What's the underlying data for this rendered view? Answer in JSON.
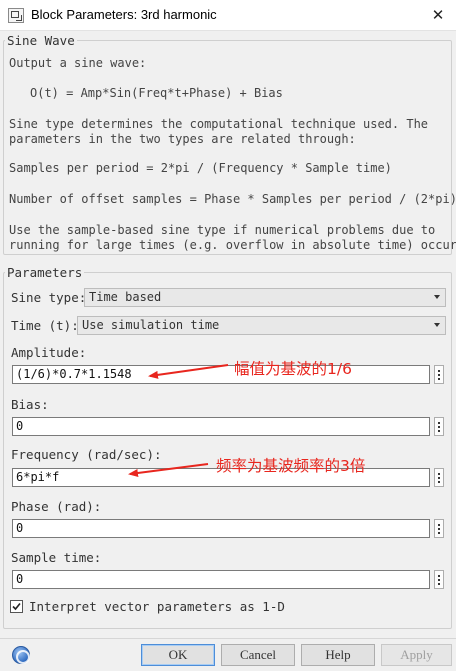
{
  "window": {
    "title": "Block Parameters: 3rd harmonic",
    "close_glyph": "✕"
  },
  "description": {
    "legend": "Sine Wave",
    "lines": [
      "Output a sine wave:",
      "O(t) = Amp*Sin(Freq*t+Phase) + Bias",
      "Sine type determines the computational technique used. The",
      "parameters in the two types are related through:",
      "Samples per period = 2*pi / (Frequency * Sample time)",
      "Number of offset samples = Phase * Samples per period / (2*pi)",
      "Use the sample-based sine type if numerical problems due to",
      "running for large times (e.g. overflow in absolute time) occur."
    ]
  },
  "parameters": {
    "legend": "Parameters",
    "sine_type": {
      "label": "Sine type:",
      "value": "Time based"
    },
    "time": {
      "label": "Time (t):",
      "value": "Use simulation time"
    },
    "amplitude": {
      "label": "Amplitude:",
      "value": "(1/6)*0.7*1.1548"
    },
    "bias": {
      "label": "Bias:",
      "value": "0"
    },
    "frequency": {
      "label": "Frequency (rad/sec):",
      "value": "6*pi*f"
    },
    "phase": {
      "label": "Phase (rad):",
      "value": "0"
    },
    "sample_time": {
      "label": "Sample time:",
      "value": "0"
    },
    "interpret_vector": {
      "label": "Interpret vector parameters as 1-D",
      "checked": true
    }
  },
  "annotations": {
    "amplitude_note": "幅值为基波的1/6",
    "frequency_note": "频率为基波频率的3倍",
    "color": "#e8261e"
  },
  "buttons": {
    "ok": "OK",
    "cancel": "Cancel",
    "help": "Help",
    "apply": "Apply"
  },
  "icons": {
    "app": "simulink-block-icon",
    "help": "help-globe-icon"
  }
}
